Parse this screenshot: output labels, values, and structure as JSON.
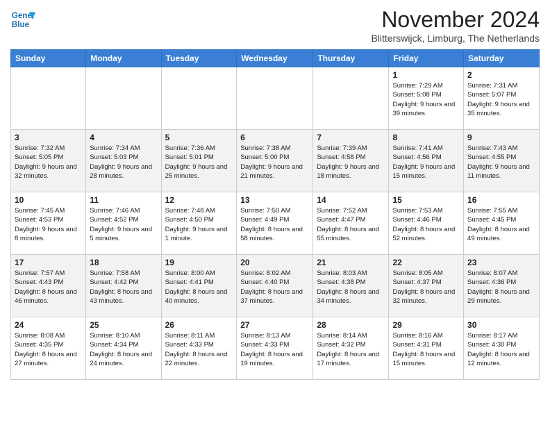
{
  "header": {
    "logo_line1": "General",
    "logo_line2": "Blue",
    "month": "November 2024",
    "location": "Blitterswijck, Limburg, The Netherlands"
  },
  "weekdays": [
    "Sunday",
    "Monday",
    "Tuesday",
    "Wednesday",
    "Thursday",
    "Friday",
    "Saturday"
  ],
  "weeks": [
    [
      {
        "day": "",
        "text": ""
      },
      {
        "day": "",
        "text": ""
      },
      {
        "day": "",
        "text": ""
      },
      {
        "day": "",
        "text": ""
      },
      {
        "day": "",
        "text": ""
      },
      {
        "day": "1",
        "text": "Sunrise: 7:29 AM\nSunset: 5:08 PM\nDaylight: 9 hours and 39 minutes."
      },
      {
        "day": "2",
        "text": "Sunrise: 7:31 AM\nSunset: 5:07 PM\nDaylight: 9 hours and 35 minutes."
      }
    ],
    [
      {
        "day": "3",
        "text": "Sunrise: 7:32 AM\nSunset: 5:05 PM\nDaylight: 9 hours and 32 minutes."
      },
      {
        "day": "4",
        "text": "Sunrise: 7:34 AM\nSunset: 5:03 PM\nDaylight: 9 hours and 28 minutes."
      },
      {
        "day": "5",
        "text": "Sunrise: 7:36 AM\nSunset: 5:01 PM\nDaylight: 9 hours and 25 minutes."
      },
      {
        "day": "6",
        "text": "Sunrise: 7:38 AM\nSunset: 5:00 PM\nDaylight: 9 hours and 21 minutes."
      },
      {
        "day": "7",
        "text": "Sunrise: 7:39 AM\nSunset: 4:58 PM\nDaylight: 9 hours and 18 minutes."
      },
      {
        "day": "8",
        "text": "Sunrise: 7:41 AM\nSunset: 4:56 PM\nDaylight: 9 hours and 15 minutes."
      },
      {
        "day": "9",
        "text": "Sunrise: 7:43 AM\nSunset: 4:55 PM\nDaylight: 9 hours and 11 minutes."
      }
    ],
    [
      {
        "day": "10",
        "text": "Sunrise: 7:45 AM\nSunset: 4:53 PM\nDaylight: 9 hours and 8 minutes."
      },
      {
        "day": "11",
        "text": "Sunrise: 7:46 AM\nSunset: 4:52 PM\nDaylight: 9 hours and 5 minutes."
      },
      {
        "day": "12",
        "text": "Sunrise: 7:48 AM\nSunset: 4:50 PM\nDaylight: 9 hours and 1 minute."
      },
      {
        "day": "13",
        "text": "Sunrise: 7:50 AM\nSunset: 4:49 PM\nDaylight: 8 hours and 58 minutes."
      },
      {
        "day": "14",
        "text": "Sunrise: 7:52 AM\nSunset: 4:47 PM\nDaylight: 8 hours and 55 minutes."
      },
      {
        "day": "15",
        "text": "Sunrise: 7:53 AM\nSunset: 4:46 PM\nDaylight: 8 hours and 52 minutes."
      },
      {
        "day": "16",
        "text": "Sunrise: 7:55 AM\nSunset: 4:45 PM\nDaylight: 8 hours and 49 minutes."
      }
    ],
    [
      {
        "day": "17",
        "text": "Sunrise: 7:57 AM\nSunset: 4:43 PM\nDaylight: 8 hours and 46 minutes."
      },
      {
        "day": "18",
        "text": "Sunrise: 7:58 AM\nSunset: 4:42 PM\nDaylight: 8 hours and 43 minutes."
      },
      {
        "day": "19",
        "text": "Sunrise: 8:00 AM\nSunset: 4:41 PM\nDaylight: 8 hours and 40 minutes."
      },
      {
        "day": "20",
        "text": "Sunrise: 8:02 AM\nSunset: 4:40 PM\nDaylight: 8 hours and 37 minutes."
      },
      {
        "day": "21",
        "text": "Sunrise: 8:03 AM\nSunset: 4:38 PM\nDaylight: 8 hours and 34 minutes."
      },
      {
        "day": "22",
        "text": "Sunrise: 8:05 AM\nSunset: 4:37 PM\nDaylight: 8 hours and 32 minutes."
      },
      {
        "day": "23",
        "text": "Sunrise: 8:07 AM\nSunset: 4:36 PM\nDaylight: 8 hours and 29 minutes."
      }
    ],
    [
      {
        "day": "24",
        "text": "Sunrise: 8:08 AM\nSunset: 4:35 PM\nDaylight: 8 hours and 27 minutes."
      },
      {
        "day": "25",
        "text": "Sunrise: 8:10 AM\nSunset: 4:34 PM\nDaylight: 8 hours and 24 minutes."
      },
      {
        "day": "26",
        "text": "Sunrise: 8:11 AM\nSunset: 4:33 PM\nDaylight: 8 hours and 22 minutes."
      },
      {
        "day": "27",
        "text": "Sunrise: 8:13 AM\nSunset: 4:33 PM\nDaylight: 8 hours and 19 minutes."
      },
      {
        "day": "28",
        "text": "Sunrise: 8:14 AM\nSunset: 4:32 PM\nDaylight: 8 hours and 17 minutes."
      },
      {
        "day": "29",
        "text": "Sunrise: 8:16 AM\nSunset: 4:31 PM\nDaylight: 8 hours and 15 minutes."
      },
      {
        "day": "30",
        "text": "Sunrise: 8:17 AM\nSunset: 4:30 PM\nDaylight: 8 hours and 12 minutes."
      }
    ]
  ]
}
